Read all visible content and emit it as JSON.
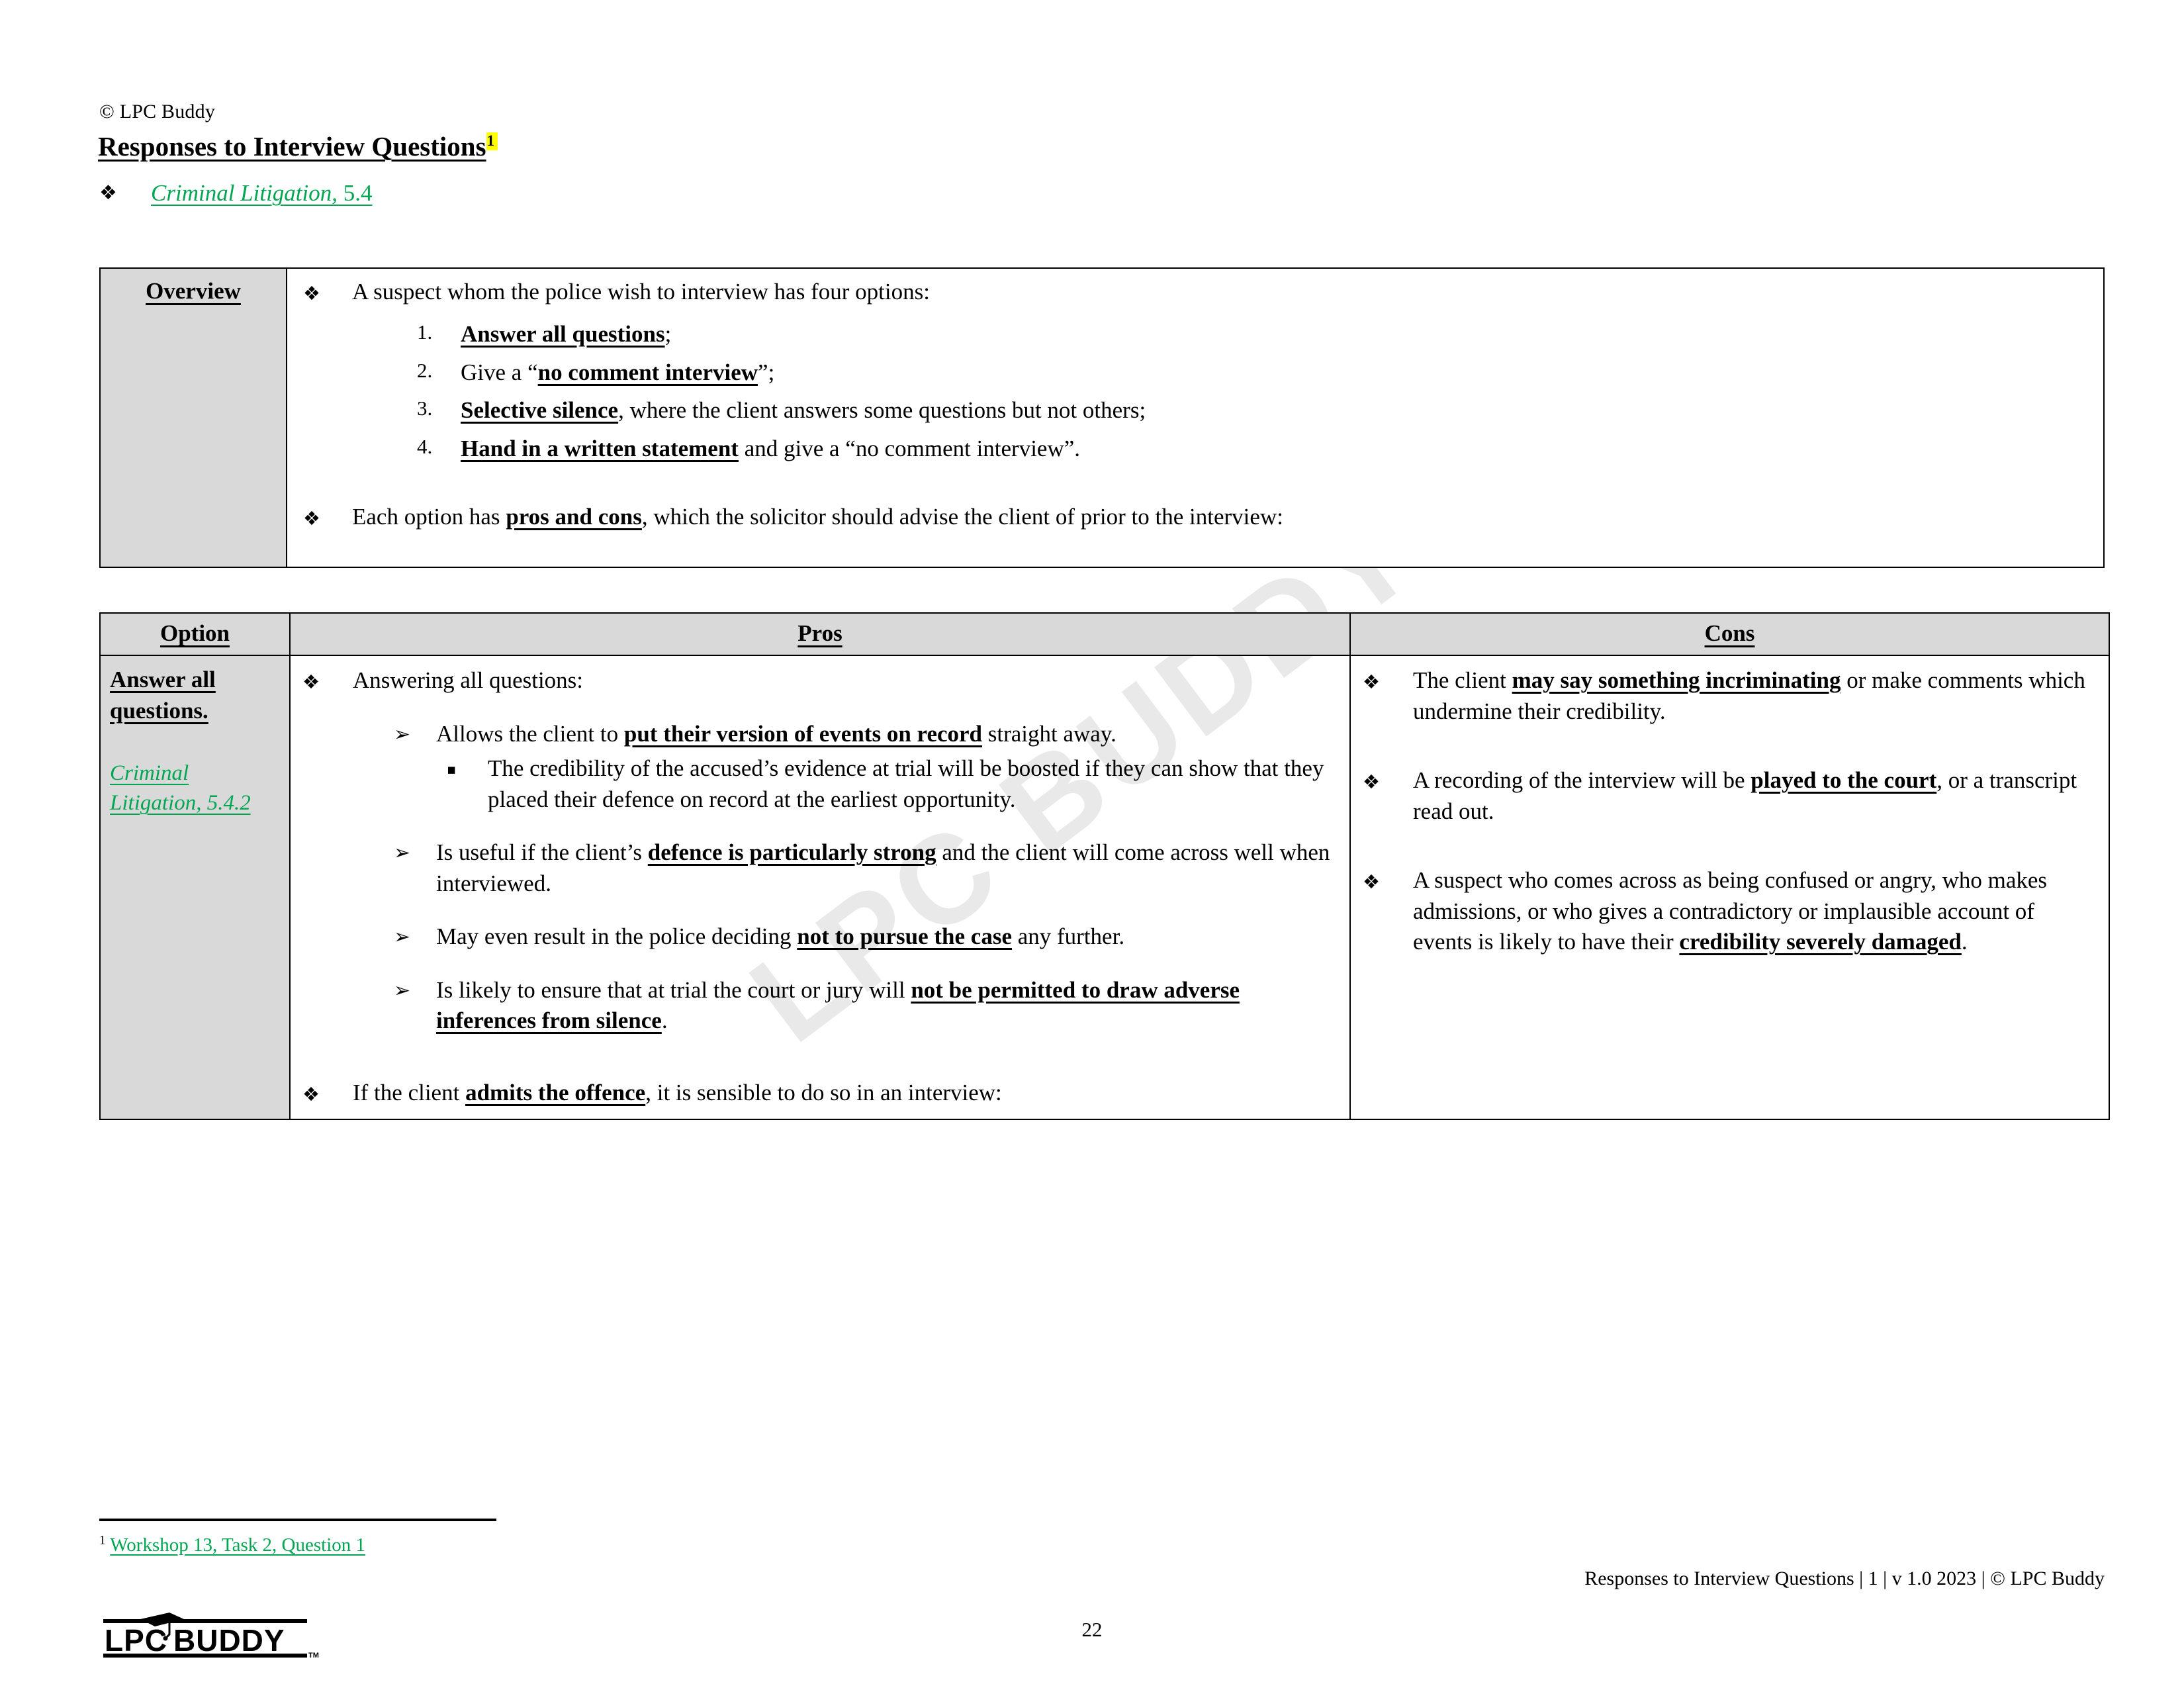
{
  "header": {
    "copyright": "© LPC Buddy",
    "title": "Responses to Interview Questions",
    "footnote_marker": "1",
    "reference_italic": "Criminal Litigation,",
    "reference_plain": " 5.4",
    "bullet_glyph": "❖"
  },
  "watermark": {
    "text": "LPC BUDDY"
  },
  "overview": {
    "label": "Overview",
    "intro": "A suspect whom the police wish to interview has four options:",
    "options": [
      {
        "bold": "Answer all questions",
        "rest": ";"
      },
      {
        "pre": "Give a “",
        "bold": "no comment interview",
        "rest": "”;"
      },
      {
        "bold": "Selective silence",
        "rest": ", where the client answers some questions but not others;"
      },
      {
        "bold": "Hand in a written statement",
        "rest": " and give a “no comment interview”."
      }
    ],
    "closing_pre": "Each option has ",
    "closing_bold": "pros and cons",
    "closing_post": ", which the solicitor should advise the client of prior to the interview:"
  },
  "pros_cons_table": {
    "headers": {
      "option": "Option",
      "pros": "Pros",
      "cons": "Cons"
    },
    "row": {
      "option_title": "Answer all questions.",
      "option_reference": "Criminal Litigation, 5.4.2",
      "pros": {
        "lead": "Answering all questions:",
        "items": [
          {
            "pre": "Allows the client to ",
            "bold": "put their version of events on record",
            "post": " straight away.",
            "sub": "The credibility of the accused’s evidence at trial will be boosted if they can show that they placed their defence on record at the earliest opportunity."
          },
          {
            "pre": "Is useful if the client’s ",
            "bold": "defence is particularly strong",
            "post": " and the client will come across well when interviewed."
          },
          {
            "pre": "May even result in the police deciding ",
            "bold": "not to pursue the case",
            "post": " any further."
          },
          {
            "pre": "Is likely to ensure that at trial the court or jury will ",
            "bold": "not be permitted to draw adverse inferences from silence",
            "post": "."
          }
        ],
        "tail_pre": "If the client ",
        "tail_bold": "admits the offence",
        "tail_post": ", it is sensible to do so in an interview:"
      },
      "cons": [
        {
          "pre": "The client ",
          "bold": "may say something incriminating",
          "post": " or make comments which undermine their credibility."
        },
        {
          "pre": "A recording of the interview will be ",
          "bold": "played to the court",
          "post": ", or a transcript read out."
        },
        {
          "pre": "A suspect who comes across as being confused or angry, who makes admissions, or who gives a contradictory or implausible account of events is likely to have their ",
          "bold": "credibility severely damaged",
          "post": "."
        }
      ]
    },
    "bullets": {
      "level1": "❖",
      "level2": "➢",
      "level3": "▪"
    }
  },
  "footnote": {
    "marker": "1",
    "text": "Workshop 13, Task 2, Question 1"
  },
  "footer": {
    "right_text": "Responses to Interview Questions | 1 | v 1.0 2023 | © LPC Buddy",
    "page_number": "22",
    "logo_text": "LPC BUDDY",
    "logo_tm": "TM"
  },
  "colors": {
    "green_link": "#00a651",
    "header_fill": "#d9d9d9",
    "highlight": "#ffff00",
    "watermark": "#e9e9e9"
  }
}
